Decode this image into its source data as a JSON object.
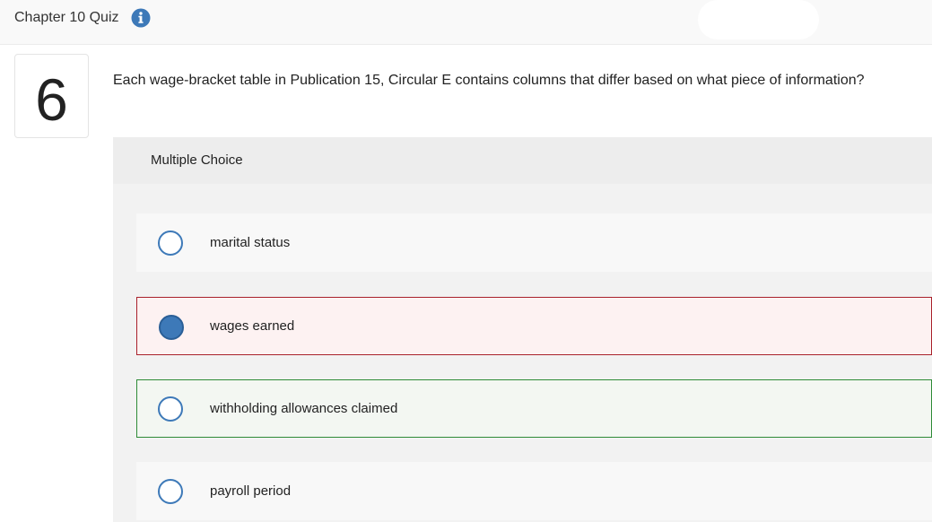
{
  "header": {
    "title": "Chapter 10 Quiz",
    "info_icon": "info-icon"
  },
  "question": {
    "number": "6",
    "text": "Each wage-bracket table in Publication 15, Circular E contains columns that differ based on what piece of information?",
    "type_label": "Multiple Choice"
  },
  "options": [
    {
      "label": "marital status",
      "selected": false,
      "status": "neutral"
    },
    {
      "label": "wages earned",
      "selected": true,
      "status": "incorrect"
    },
    {
      "label": "withholding allowances claimed",
      "selected": false,
      "status": "correct"
    },
    {
      "label": "payroll period",
      "selected": false,
      "status": "neutral"
    }
  ],
  "colors": {
    "accent": "#3d79b8",
    "incorrect_border": "#a9212b",
    "correct_border": "#2e8b37"
  }
}
